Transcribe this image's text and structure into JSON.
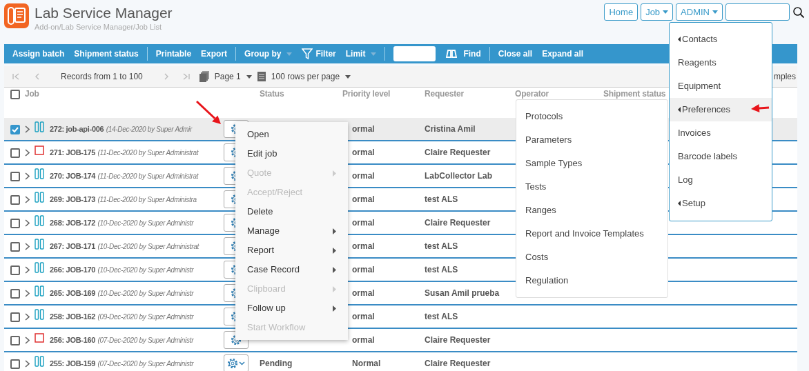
{
  "header": {
    "title": "Lab Service Manager",
    "breadcrumb": "Add-on/Lab Service Manager/Job List"
  },
  "nav": [
    {
      "label": "Home",
      "dropdown": false
    },
    {
      "label": "Job",
      "dropdown": true
    },
    {
      "label": "ADMIN",
      "dropdown": true
    }
  ],
  "toolbar": [
    [
      {
        "label": "Assign batch",
        "kind": "button"
      },
      {
        "label": "Shipment status",
        "kind": "button"
      }
    ],
    [
      {
        "label": "Printable",
        "kind": "button"
      },
      {
        "label": "Export",
        "kind": "button"
      }
    ],
    [
      {
        "label": "Group by",
        "kind": "dropdown"
      },
      {
        "label": "Filter",
        "kind": "filter"
      },
      {
        "label": "Limit",
        "kind": "dropdown"
      }
    ],
    [
      {
        "kind": "field"
      },
      {
        "label": "Find",
        "kind": "find"
      }
    ],
    [
      {
        "label": "Close all",
        "kind": "button"
      },
      {
        "label": "Expand all",
        "kind": "button"
      }
    ]
  ],
  "pager": {
    "records": "Records from 1 to 100",
    "page": "Page 1",
    "rows_per_page": "100 rows per page",
    "right_label": "mples"
  },
  "table": {
    "select_all_checked": false,
    "columns": [
      "Job",
      "Status",
      "Priority level",
      "Requester",
      "Operator",
      "Shipment status"
    ],
    "rows": [
      {
        "checked": true,
        "kind": "pause",
        "job": "272: job-api-006",
        "info": "(14-Dec-2020 by Super Admir",
        "priority": "ormal",
        "requester": "Cristina Amil",
        "expanded_caret": false
      },
      {
        "checked": false,
        "kind": "square",
        "job": "271: JOB-175",
        "info": "(11-Dec-2020 by Super Administrat",
        "priority": "ormal",
        "requester": "Claire Requester",
        "expanded_caret": false
      },
      {
        "checked": false,
        "kind": "pause",
        "job": "270: JOB-174",
        "info": "(11-Dec-2020 by Super Administrat",
        "priority": "ormal",
        "requester": "LabCollector Lab",
        "expanded_caret": false
      },
      {
        "checked": false,
        "kind": "pause",
        "job": "269: JOB-173",
        "info": "(11-Dec-2020 by Super Administra",
        "priority": "ormal",
        "requester": "test ALS",
        "expanded_caret": false
      },
      {
        "checked": false,
        "kind": "pause",
        "job": "268: JOB-172",
        "info": "(10-Dec-2020 by Super Administr",
        "priority": "ormal",
        "requester": "Claire Requester",
        "expanded_caret": false
      },
      {
        "checked": false,
        "kind": "pause",
        "job": "267: JOB-171",
        "info": "(10-Dec-2020 by Super Administrat",
        "priority": "ormal",
        "requester": "test ALS",
        "expanded_caret": false
      },
      {
        "checked": false,
        "kind": "pause",
        "job": "266: JOB-170",
        "info": "(10-Dec-2020 by Super Administr",
        "priority": "ormal",
        "requester": "test ALS",
        "expanded_caret": false
      },
      {
        "checked": false,
        "kind": "pause",
        "job": "265: JOB-169",
        "info": "(10-Dec-2020 by Super Administr",
        "priority": "ormal",
        "requester": "Susan Amil prueba",
        "expanded_caret": false
      },
      {
        "checked": false,
        "kind": "pause",
        "job": "258: JOB-162",
        "info": "(09-Dec-2020 by Super Administr",
        "priority": "ormal",
        "requester": "test ALS",
        "expanded_caret": false
      },
      {
        "checked": false,
        "kind": "square",
        "job": "256: JOB-160",
        "info": "(07-Dec-2020 by Super Administr",
        "priority": "ormal",
        "requester": "Claire Requester",
        "expanded_caret": false
      },
      {
        "checked": false,
        "kind": "pause",
        "job": "255: JOB-159",
        "info": "(07-Dec-2020 by Super Administr",
        "status": "Pending",
        "priority": "Normal",
        "requester": "Claire Requester",
        "expanded_caret": true
      }
    ]
  },
  "row_menu": {
    "pointer_arrow": true,
    "items": [
      {
        "label": "Open",
        "disabled": false,
        "has_submenu": false
      },
      {
        "label": "Edit job",
        "disabled": false,
        "has_submenu": false
      },
      {
        "label": "Quote",
        "disabled": true,
        "has_submenu": true
      },
      {
        "label": "Accept/Reject",
        "disabled": true,
        "has_submenu": false
      },
      {
        "label": "Delete",
        "disabled": false,
        "has_submenu": false
      },
      {
        "label": "Manage",
        "disabled": false,
        "has_submenu": true
      },
      {
        "label": "Report",
        "disabled": false,
        "has_submenu": true
      },
      {
        "label": "Case Record",
        "disabled": false,
        "has_submenu": true
      },
      {
        "label": "Clipboard",
        "disabled": true,
        "has_submenu": true
      },
      {
        "label": "Follow up",
        "disabled": false,
        "has_submenu": true
      },
      {
        "label": "Start Workflow",
        "disabled": true,
        "has_submenu": false
      }
    ]
  },
  "admin_menu": {
    "pointer_arrow": true,
    "items": [
      {
        "label": "Contacts",
        "has_submenu": true,
        "selected": false
      },
      {
        "label": "Reagents",
        "has_submenu": false,
        "selected": false
      },
      {
        "label": "Equipment",
        "has_submenu": false,
        "selected": false
      },
      {
        "label": "Preferences",
        "has_submenu": true,
        "selected": true
      },
      {
        "label": "Invoices",
        "has_submenu": false,
        "selected": false
      },
      {
        "label": "Barcode labels",
        "has_submenu": false,
        "selected": false
      },
      {
        "label": "Log",
        "has_submenu": false,
        "selected": false
      },
      {
        "label": "Setup",
        "has_submenu": true,
        "selected": false
      }
    ]
  },
  "preferences_submenu": {
    "items": [
      "Protocols",
      "Parameters",
      "Sample Types",
      "Tests",
      "Ranges",
      "Report and Invoice Templates",
      "Costs",
      "Regulation"
    ]
  }
}
